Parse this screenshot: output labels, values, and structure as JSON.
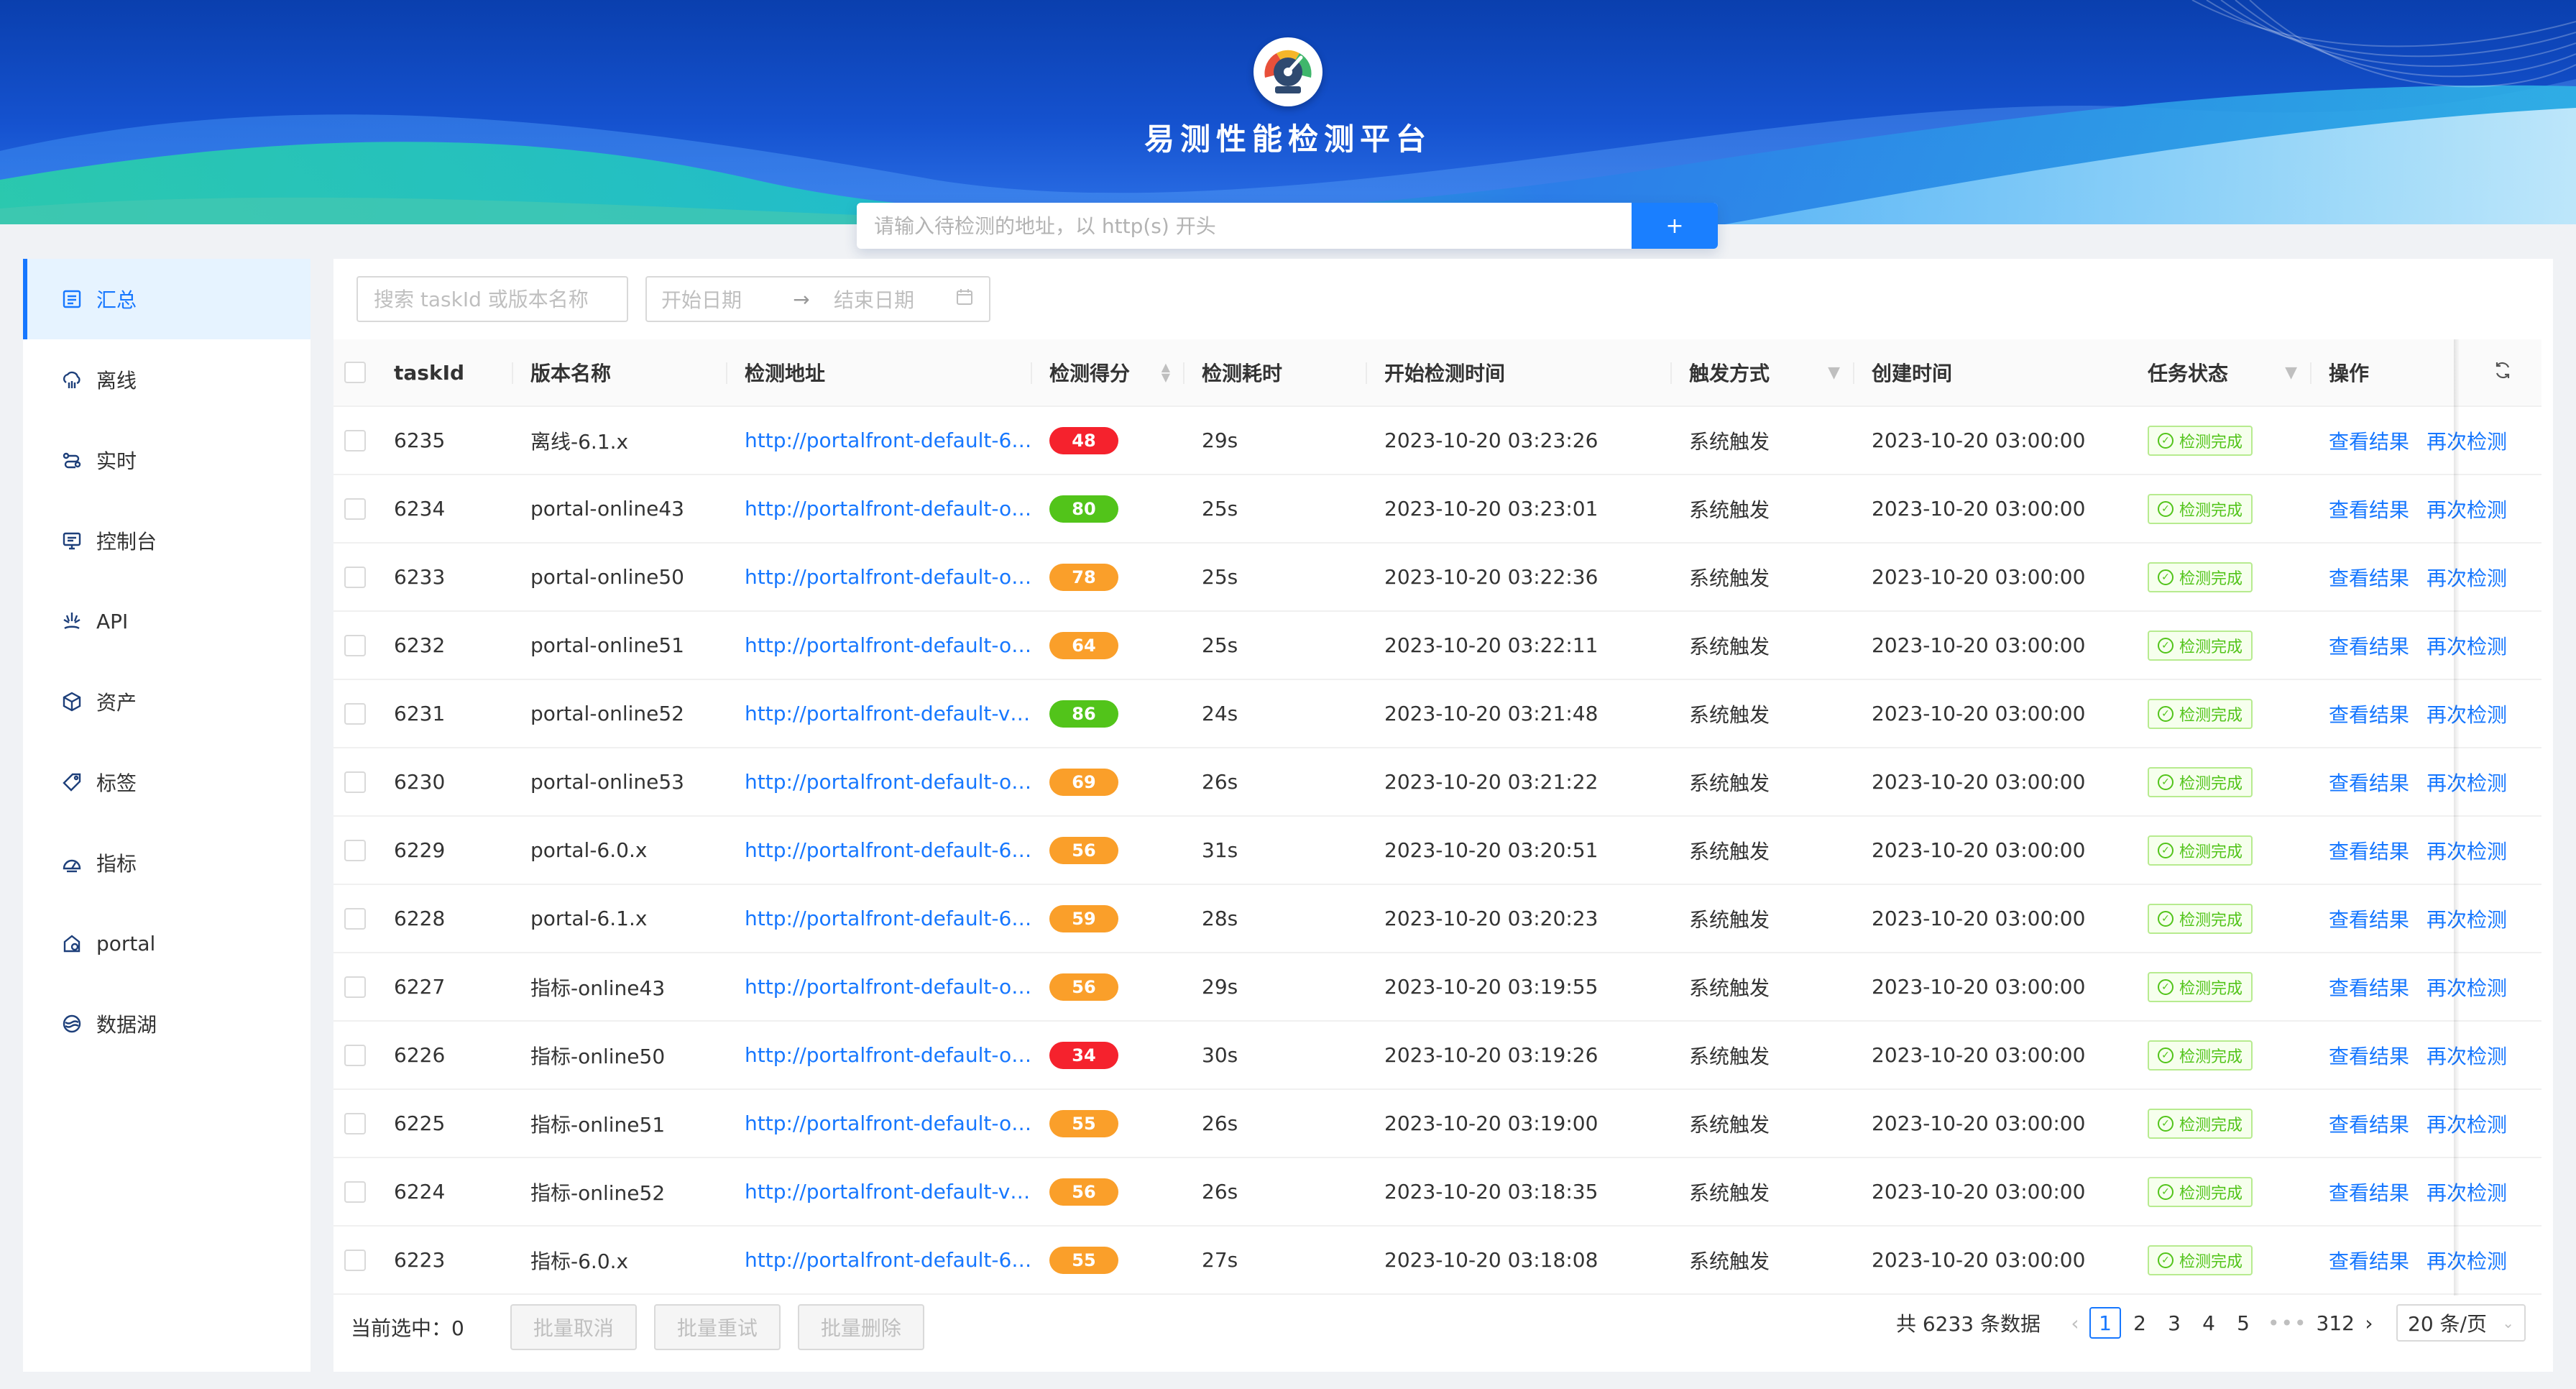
{
  "header": {
    "title": "易测性能检测平台",
    "search_placeholder": "请输入待检测的地址，以 http(s) 开头",
    "submit_label": "+"
  },
  "sidebar": {
    "items": [
      {
        "label": "汇总",
        "icon": "summary-icon",
        "active": true
      },
      {
        "label": "离线",
        "icon": "offline-icon"
      },
      {
        "label": "实时",
        "icon": "realtime-icon"
      },
      {
        "label": "控制台",
        "icon": "console-icon"
      },
      {
        "label": "API",
        "icon": "api-icon"
      },
      {
        "label": "资产",
        "icon": "asset-icon"
      },
      {
        "label": "标签",
        "icon": "tag-icon"
      },
      {
        "label": "指标",
        "icon": "metric-icon"
      },
      {
        "label": "portal",
        "icon": "portal-icon"
      },
      {
        "label": "数据湖",
        "icon": "datalake-icon"
      }
    ]
  },
  "filters": {
    "search_placeholder": "搜索 taskId 或版本名称",
    "date_start_placeholder": "开始日期",
    "date_end_placeholder": "结束日期"
  },
  "table": {
    "columns": {
      "taskId": "taskId",
      "name": "版本名称",
      "url": "检测地址",
      "score": "检测得分",
      "duration": "检测耗时",
      "start": "开始检测时间",
      "trigger": "触发方式",
      "created": "创建时间",
      "status": "任务状态",
      "ops": "操作"
    },
    "op_view": "查看结果",
    "op_retry": "再次检测",
    "score_colors": {
      "red": "#f5222d",
      "green": "#52c41a",
      "orange": "#fa9f2a"
    },
    "rows": [
      {
        "id": "6235",
        "name": "离线-6.1.x",
        "url": "http://portalfront-default-61...",
        "score": "48",
        "color": "red",
        "duration": "29s",
        "start": "2023-10-20 03:23:26",
        "trigger": "系统触发",
        "created": "2023-10-20 03:00:00",
        "status": "检测完成"
      },
      {
        "id": "6234",
        "name": "portal-online43",
        "url": "http://portalfront-default-onl...",
        "score": "80",
        "color": "green",
        "duration": "25s",
        "start": "2023-10-20 03:23:01",
        "trigger": "系统触发",
        "created": "2023-10-20 03:00:00",
        "status": "检测完成"
      },
      {
        "id": "6233",
        "name": "portal-online50",
        "url": "http://portalfront-default-onl...",
        "score": "78",
        "color": "orange",
        "duration": "25s",
        "start": "2023-10-20 03:22:36",
        "trigger": "系统触发",
        "created": "2023-10-20 03:00:00",
        "status": "检测完成"
      },
      {
        "id": "6232",
        "name": "portal-online51",
        "url": "http://portalfront-default-onl...",
        "score": "64",
        "color": "orange",
        "duration": "25s",
        "start": "2023-10-20 03:22:11",
        "trigger": "系统触发",
        "created": "2023-10-20 03:00:00",
        "status": "检测完成"
      },
      {
        "id": "6231",
        "name": "portal-online52",
        "url": "http://portalfront-default-v5...",
        "score": "86",
        "color": "green",
        "duration": "24s",
        "start": "2023-10-20 03:21:48",
        "trigger": "系统触发",
        "created": "2023-10-20 03:00:00",
        "status": "检测完成"
      },
      {
        "id": "6230",
        "name": "portal-online53",
        "url": "http://portalfront-default-onl...",
        "score": "69",
        "color": "orange",
        "duration": "26s",
        "start": "2023-10-20 03:21:22",
        "trigger": "系统触发",
        "created": "2023-10-20 03:00:00",
        "status": "检测完成"
      },
      {
        "id": "6229",
        "name": "portal-6.0.x",
        "url": "http://portalfront-default-60...",
        "score": "56",
        "color": "orange",
        "duration": "31s",
        "start": "2023-10-20 03:20:51",
        "trigger": "系统触发",
        "created": "2023-10-20 03:00:00",
        "status": "检测完成"
      },
      {
        "id": "6228",
        "name": "portal-6.1.x",
        "url": "http://portalfront-default-61...",
        "score": "59",
        "color": "orange",
        "duration": "28s",
        "start": "2023-10-20 03:20:23",
        "trigger": "系统触发",
        "created": "2023-10-20 03:00:00",
        "status": "检测完成"
      },
      {
        "id": "6227",
        "name": "指标-online43",
        "url": "http://portalfront-default-onl...",
        "score": "56",
        "color": "orange",
        "duration": "29s",
        "start": "2023-10-20 03:19:55",
        "trigger": "系统触发",
        "created": "2023-10-20 03:00:00",
        "status": "检测完成"
      },
      {
        "id": "6226",
        "name": "指标-online50",
        "url": "http://portalfront-default-onl...",
        "score": "34",
        "color": "red",
        "duration": "30s",
        "start": "2023-10-20 03:19:26",
        "trigger": "系统触发",
        "created": "2023-10-20 03:00:00",
        "status": "检测完成"
      },
      {
        "id": "6225",
        "name": "指标-online51",
        "url": "http://portalfront-default-onl...",
        "score": "55",
        "color": "orange",
        "duration": "26s",
        "start": "2023-10-20 03:19:00",
        "trigger": "系统触发",
        "created": "2023-10-20 03:00:00",
        "status": "检测完成"
      },
      {
        "id": "6224",
        "name": "指标-online52",
        "url": "http://portalfront-default-v5...",
        "score": "56",
        "color": "orange",
        "duration": "26s",
        "start": "2023-10-20 03:18:35",
        "trigger": "系统触发",
        "created": "2023-10-20 03:00:00",
        "status": "检测完成"
      },
      {
        "id": "6223",
        "name": "指标-6.0.x",
        "url": "http://portalfront-default-60...",
        "score": "55",
        "color": "orange",
        "duration": "27s",
        "start": "2023-10-20 03:18:08",
        "trigger": "系统触发",
        "created": "2023-10-20 03:00:00",
        "status": "检测完成"
      }
    ]
  },
  "footer": {
    "selected_label": "当前选中：",
    "selected_count": "0",
    "batch_cancel": "批量取消",
    "batch_retry": "批量重试",
    "batch_delete": "批量删除",
    "total_text": "共 6233 条数据",
    "pages": [
      "1",
      "2",
      "3",
      "4",
      "5"
    ],
    "current_page": "1",
    "last_page": "312",
    "dots": "•••",
    "page_size": "20 条/页"
  }
}
